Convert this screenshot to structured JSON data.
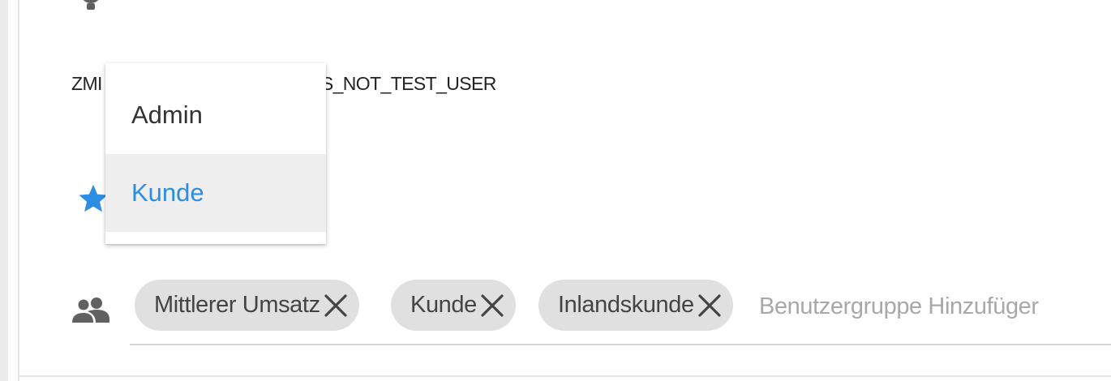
{
  "property": {
    "label": "ZMI                    RSPROPERTIES_USER_IS_NOT_TEST_USER"
  },
  "role_menu": {
    "items": [
      {
        "label": "Admin",
        "selected": false
      },
      {
        "label": "Kunde",
        "selected": true
      }
    ],
    "selected_color": "#2c8ee3"
  },
  "user_groups": {
    "chips": [
      {
        "label": "Mittlerer Umsatz"
      },
      {
        "label": "Kunde"
      },
      {
        "label": "Inlandskunde"
      }
    ],
    "input_placeholder": "Benutzergruppe Hinzufüger",
    "input_value": ""
  },
  "icons": {
    "top": "settings-icon",
    "star": "star-icon",
    "groups": "people-icon",
    "remove": "close-icon"
  },
  "colors": {
    "accent": "#2c8ee3",
    "chip_bg": "#e0e0e0",
    "icon_gray": "#616161"
  }
}
